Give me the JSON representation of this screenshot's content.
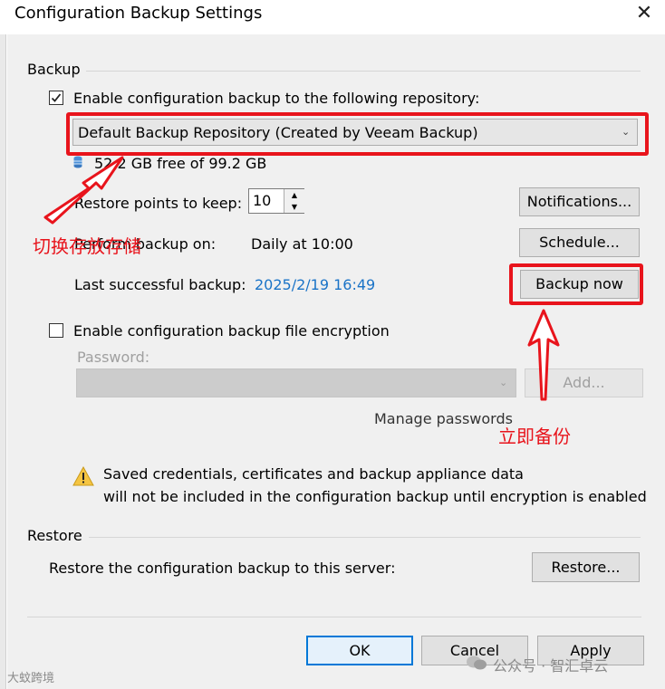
{
  "window": {
    "title": "Configuration Backup Settings",
    "close_glyph": "✕"
  },
  "backup_section": {
    "header": "Backup",
    "enable_label": "Enable configuration backup to the following repository:",
    "enable_checked": true,
    "repository_value": "Default Backup Repository (Created by Veeam Backup)",
    "free_space": "52.2 GB free of 99.2 GB",
    "restore_points_label": "Restore points to keep:",
    "restore_points_value": "10",
    "notifications_button": "Notifications...",
    "perform_label": "Perform backup on:",
    "perform_value": "Daily at 10:00",
    "schedule_button": "Schedule...",
    "last_label": "Last successful backup:",
    "last_value": "2025/2/19 16:49",
    "backup_now_button": "Backup now"
  },
  "encryption": {
    "enable_label": "Enable configuration backup file encryption",
    "enable_checked": false,
    "password_label": "Password:",
    "add_button": "Add...",
    "manage_link": "Manage passwords",
    "warning_line1": "Saved credentials, certificates and backup appliance data",
    "warning_line2": "will not be included in the configuration backup until encryption is enabled"
  },
  "restore_section": {
    "header": "Restore",
    "restore_label": "Restore the configuration backup to this server:",
    "restore_button": "Restore..."
  },
  "footer": {
    "ok_button": "OK",
    "cancel_button": "Cancel",
    "apply_button": "Apply"
  },
  "annotations": {
    "switch_storage": "切换存放存储",
    "backup_immediately": "立即备份",
    "color": "#e8141c"
  },
  "watermarks": {
    "right": "公众号 · 智汇卓云",
    "left": "大蚊跨境"
  }
}
